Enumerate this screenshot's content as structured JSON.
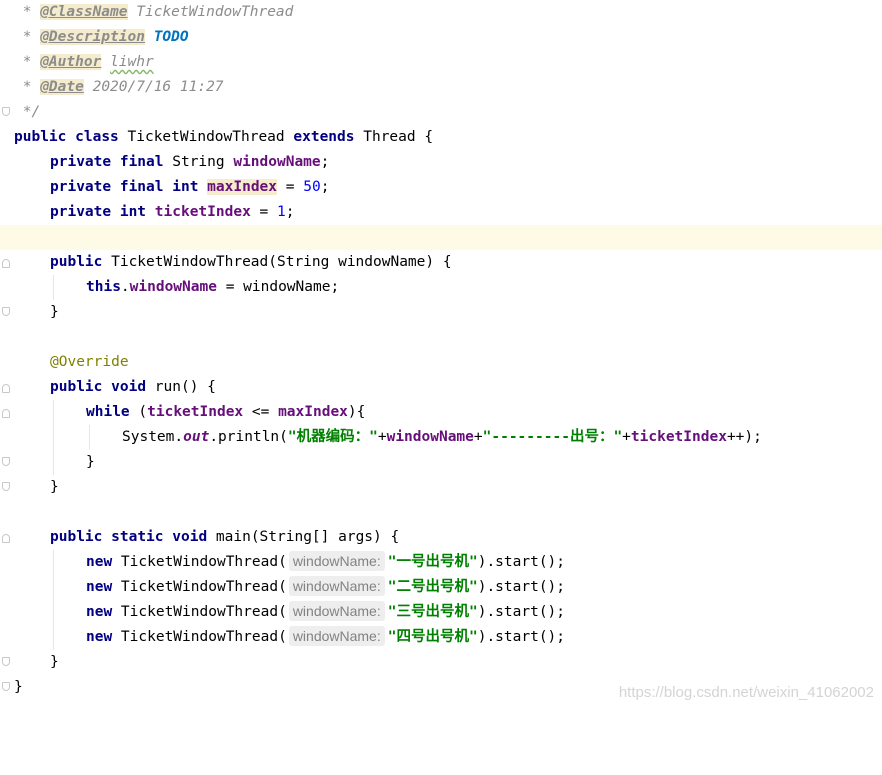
{
  "javadoc": {
    "star": " * ",
    "end": " */",
    "class_name_tag": "@ClassName",
    "class_name_value": "TicketWindowThread",
    "description_tag": "@Description",
    "description_value": "TODO",
    "author_tag": "@Author",
    "author_value": "liwhr",
    "date_tag": "@Date",
    "date_value": "2020/7/16 11:27"
  },
  "kw": {
    "public": "public",
    "class": "class",
    "extends": "extends",
    "private": "private",
    "final": "final",
    "int": "int",
    "this": "this",
    "void": "void",
    "while": "while",
    "static": "static",
    "new": "new"
  },
  "code": {
    "class_name": " TicketWindowThread ",
    "super_class": " Thread {",
    "string_type": " String ",
    "int_type_sp": " ",
    "field_window_name": "windowName",
    "field_max_index": "maxIndex",
    "field_ticket_index": "ticketIndex",
    "semicolon": ";",
    "assign": " = ",
    "max_index_value": "50",
    "ticket_index_value": "1",
    "constructor_sig": " TicketWindowThread(String windowName) {",
    "this_dot": ".",
    "assign_param": " = windowName;",
    "close_brace": "}",
    "override_annotation": "@Override",
    "run_sig": " run() {",
    "while_open": " (",
    "le": " <= ",
    "while_close": "){",
    "system_prefix": "System.",
    "system_out": "out",
    "println_open": ".println(",
    "str_machine": "\"机器编码：\"",
    "plus": "+",
    "str_ticket": "\"---------出号：\"",
    "inc_close": "++);",
    "main_sig": " main(String[] args) {",
    "ctor_call": " TicketWindowThread(",
    "hint_label": "windowName:",
    "start_call": ").start();",
    "str_window_1": "\"一号出号机\"",
    "str_window_2": "\"二号出号机\"",
    "str_window_3": "\"三号出号机\"",
    "str_window_4": "\"四号出号机\""
  },
  "watermark": "https://blog.csdn.net/weixin_41062002"
}
